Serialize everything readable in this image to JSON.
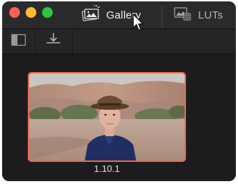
{
  "window": {
    "tabs": [
      {
        "label": "Gallery",
        "icon": "gallery-icon",
        "active": true
      },
      {
        "label": "LUTs",
        "icon": "luts-icon",
        "active": false
      }
    ]
  },
  "toolbar": {
    "buttons": [
      {
        "icon": "sidebar-toggle-icon"
      },
      {
        "icon": "download-tray-icon"
      }
    ]
  },
  "gallery": {
    "items": [
      {
        "label": "1.10.1",
        "selected": true
      }
    ],
    "selection_color": "#e86a4f"
  }
}
